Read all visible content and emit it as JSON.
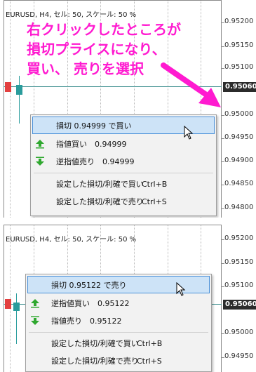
{
  "chart": {
    "title": "EURUSD, H4, セル: 50, スケール: 50 %",
    "current_price": "0.95060"
  },
  "panel1": {
    "axis": [
      "0.95200",
      "0.95150",
      "0.95100",
      "0.95000",
      "0.94950",
      "0.94900",
      "0.94850",
      "0.94800"
    ],
    "annotation": [
      "右クリックしたところが",
      "損切プライスになり、",
      "買い、 売りを選択"
    ],
    "menu": {
      "item_main": "損切 0.94999 で買い",
      "item_limit": "指値買い　0.94999",
      "item_stop": "逆指値売り　0.94999",
      "item_set_buy": "設定した損切/利確で買い",
      "item_set_buy_key": "Ctrl+B",
      "item_set_sell": "設定した損切/利確で売り",
      "item_set_sell_key": "Ctrl+S"
    }
  },
  "panel2": {
    "axis": [
      "0.95200",
      "0.95150",
      "0.95100",
      "0.95000",
      "0.94950"
    ],
    "menu": {
      "item_main": "損切 0.95122 で売り",
      "item_stop": "逆指値買い　0.95122",
      "item_limit": "指値売り　0.95122",
      "item_set_buy": "設定した損切/利確で買い",
      "item_set_buy_key": "Ctrl+B",
      "item_set_sell": "設定した損切/利確で売り",
      "item_set_sell_key": "Ctrl+S"
    }
  },
  "colors": {
    "annotation": "#ff1ad0",
    "price_line": "#3b8e8e",
    "highlight_bg": "#cde3f7",
    "highlight_border": "#4a90d9",
    "arrow_green": "#2fa82f"
  },
  "icons": [
    "green-up-arrow-icon",
    "green-down-arrow-icon",
    "mouse-cursor-icon"
  ]
}
